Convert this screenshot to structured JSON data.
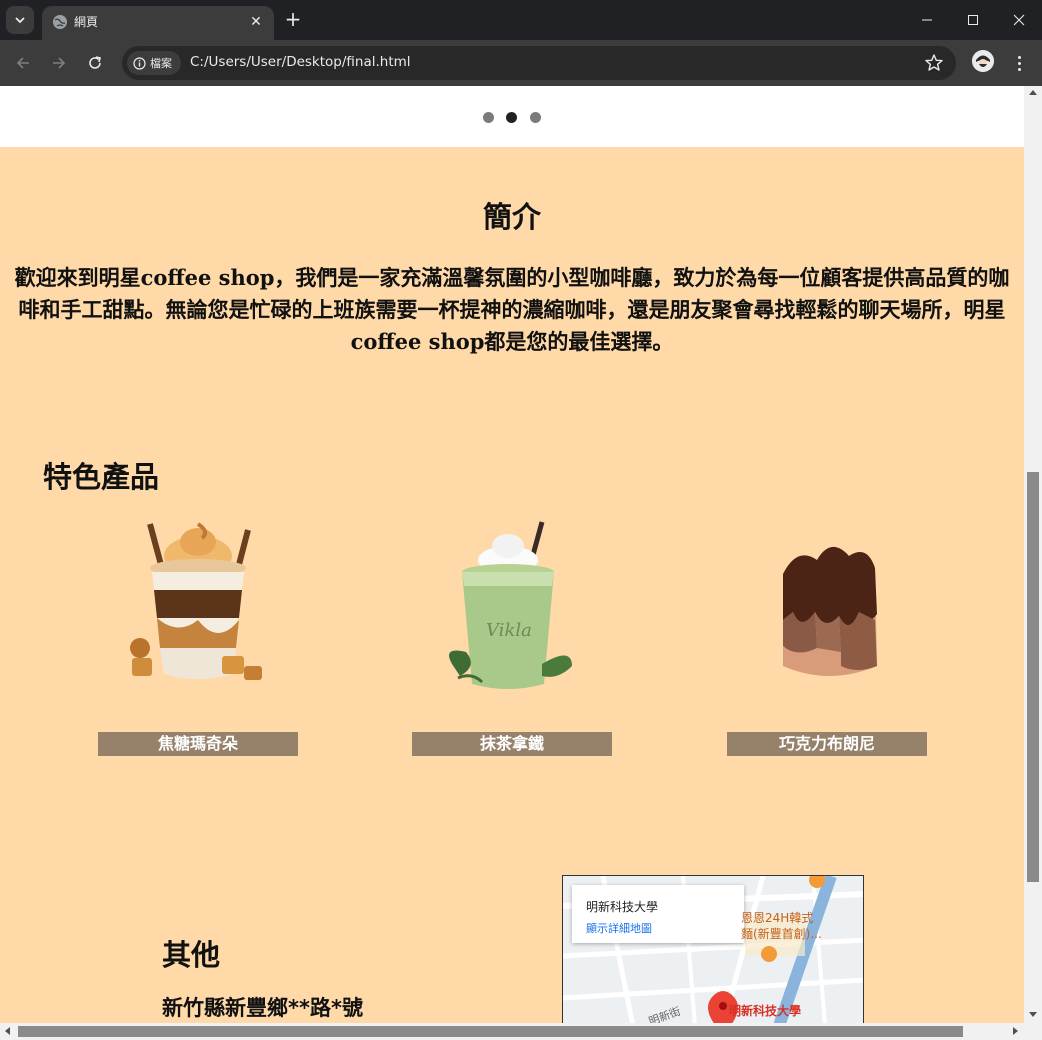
{
  "browser": {
    "tab_title": "網頁",
    "security_chip": "檔案",
    "url": "C:/Users/User/Desktop/final.html"
  },
  "carousel": {
    "dots": 3,
    "active_index": 1
  },
  "intro": {
    "title": "簡介",
    "text": "歡迎來到明星coffee shop，我們是一家充滿溫馨氛圍的小型咖啡廳，致力於為每一位顧客提供高品質的咖啡和手工甜點。無論您是忙碌的上班族需要一杯提神的濃縮咖啡，還是朋友聚會尋找輕鬆的聊天場所，明星coffee shop都是您的最佳選擇。"
  },
  "featured": {
    "title": "特色產品",
    "products": [
      {
        "label": "焦糖瑪奇朵"
      },
      {
        "label": "抹茶拿鐵"
      },
      {
        "label": "巧克力布朗尼"
      }
    ]
  },
  "other": {
    "title": "其他",
    "address": "新竹縣新豐鄉**路*號"
  },
  "map": {
    "place_name": "明新科技大學",
    "details_link": "顯示詳細地圖",
    "poi_line1": "恩恩24H韓式",
    "poi_line2": "麵(新豐首創)...",
    "marker_label": "明新科技大學",
    "street_label": "明新街"
  },
  "colors": {
    "page_bg": "#ffdaa8",
    "label_bg": "#96826a",
    "chrome_dark": "#202124",
    "chrome_toolbar": "#3c3c3c"
  }
}
